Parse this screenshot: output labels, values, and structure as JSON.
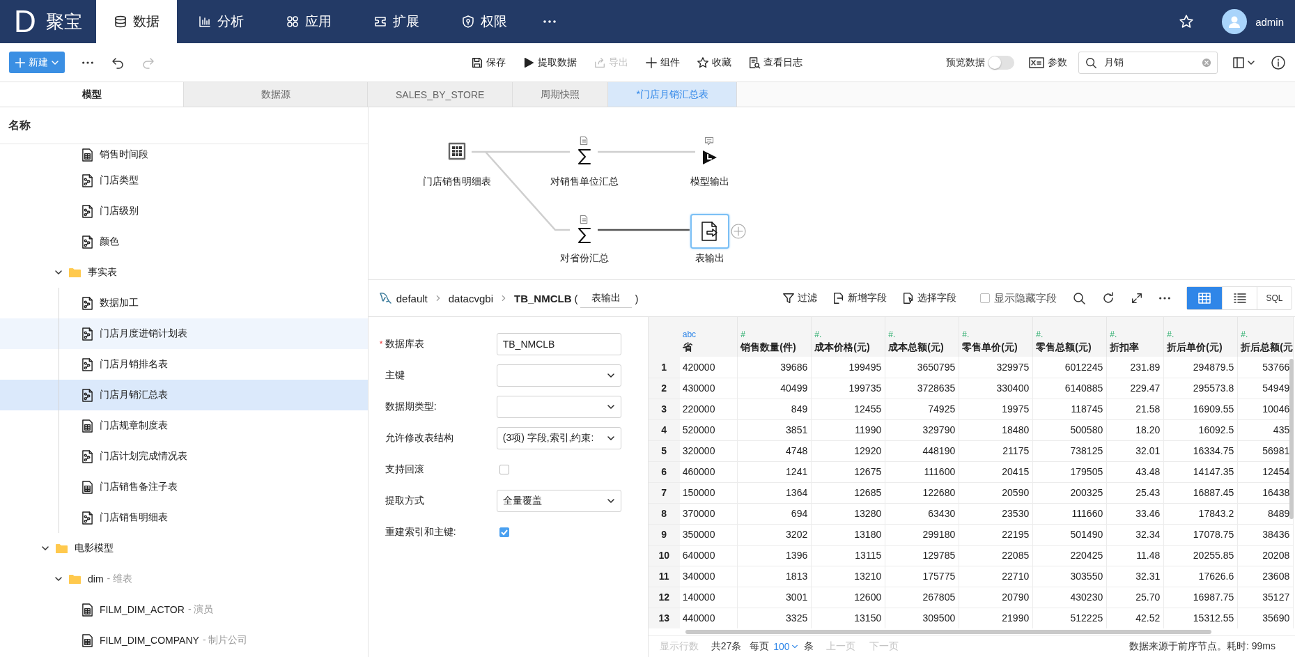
{
  "nav": {
    "logo_letter": "D",
    "product": "聚宝",
    "tabs": [
      {
        "label": "数据",
        "kind": "database",
        "selected": true
      },
      {
        "label": "分析",
        "kind": "bars",
        "selected": false
      },
      {
        "label": "应用",
        "kind": "apps",
        "selected": false
      },
      {
        "label": "扩展",
        "kind": "plugin",
        "selected": false
      },
      {
        "label": "权限",
        "kind": "shield",
        "selected": false
      }
    ],
    "user": "admin"
  },
  "toolbar": {
    "new_button": "新建",
    "undo_disabled": false,
    "redo_disabled": true,
    "actions": [
      {
        "label": "保存",
        "kind": "save",
        "disabled": false
      },
      {
        "label": "提取数据",
        "kind": "play",
        "disabled": false
      },
      {
        "label": "导出",
        "kind": "export",
        "disabled": true
      },
      {
        "label": "组件",
        "kind": "plus",
        "disabled": false
      },
      {
        "label": "收藏",
        "kind": "star",
        "disabled": false
      },
      {
        "label": "查看日志",
        "kind": "log",
        "disabled": false
      }
    ],
    "preview": {
      "label": "预览数据",
      "on": false
    },
    "params": "参数",
    "search": {
      "value": "月销"
    }
  },
  "panel_tabs": [
    {
      "label": "模型",
      "selected": true
    },
    {
      "label": "数据源",
      "selected": false
    }
  ],
  "doc_tabs": [
    {
      "label": "SALES_BY_STORE",
      "selected": false
    },
    {
      "label": "周期快照",
      "selected": false
    },
    {
      "label": "*门店月销汇总表",
      "selected": true
    }
  ],
  "tree": {
    "header": "名称",
    "items": [
      {
        "children": [
          {
            "children": [
              {
                "label": "销售时间段",
                "kind": "table",
                "selected": false,
                "hovered": false
              },
              {
                "label": "门店类型",
                "kind": "model",
                "selected": false,
                "hovered": false
              },
              {
                "label": "门店级别",
                "kind": "model",
                "selected": false,
                "hovered": false
              },
              {
                "label": "颜色",
                "kind": "model",
                "selected": false,
                "hovered": false
              }
            ]
          },
          {
            "label": "事实表",
            "kind": "folder",
            "expanded": true,
            "children": [
              {
                "label": "数据加工",
                "kind": "model",
                "selected": false,
                "hovered": false
              },
              {
                "label": "门店月度进销计划表",
                "kind": "model",
                "selected": false,
                "hovered": true
              },
              {
                "label": "门店月销排名表",
                "kind": "model",
                "selected": false,
                "hovered": false
              },
              {
                "label": "门店月销汇总表",
                "kind": "model",
                "selected": true,
                "hovered": false
              },
              {
                "label": "门店规章制度表",
                "kind": "table",
                "selected": false,
                "hovered": false
              },
              {
                "label": "门店计划完成情况表",
                "kind": "model",
                "selected": false,
                "hovered": false
              },
              {
                "label": "门店销售备注子表",
                "kind": "table",
                "selected": false,
                "hovered": false
              },
              {
                "label": "门店销售明细表",
                "kind": "model",
                "selected": false,
                "hovered": false
              }
            ]
          }
        ]
      },
      {
        "label": "电影模型",
        "kind": "folder",
        "expanded": true,
        "children": [
          {
            "label": "dim",
            "note": "- 维表",
            "kind": "folder",
            "expanded": true,
            "children": [
              {
                "label": "FILM_DIM_ACTOR",
                "note": "- 演员",
                "kind": "table",
                "selected": false,
                "hovered": false
              },
              {
                "label": "FILM_DIM_COMPANY",
                "note": "- 制片公司",
                "kind": "table",
                "selected": false,
                "hovered": false
              }
            ]
          }
        ]
      }
    ]
  },
  "flow": {
    "nodes": [
      {
        "label": "门店销售明细表",
        "kind": "source_table",
        "selected": false
      },
      {
        "label": "对销售单位汇总",
        "kind": "aggregate",
        "selected": false
      },
      {
        "label": "模型输出",
        "kind": "model_output",
        "selected": false
      },
      {
        "label": "对省份汇总",
        "kind": "aggregate",
        "selected": false
      },
      {
        "label": "表输出",
        "kind": "table_output",
        "selected": true
      }
    ]
  },
  "breadcrumb": {
    "items": [
      "default",
      "datacvgbi",
      "TB_NMCLB"
    ],
    "paren_open": "(",
    "node_type": "表输出",
    "paren_close": ")"
  },
  "data_toolbar": {
    "actions": [
      {
        "label": "过滤",
        "kind": "filter"
      },
      {
        "label": "新增字段",
        "kind": "add_field"
      },
      {
        "label": "选择字段",
        "kind": "select_field"
      }
    ],
    "show_hidden": {
      "label": "显示隐藏字段",
      "checked": false
    },
    "views": [
      {
        "kind": "grid",
        "selected": true
      },
      {
        "kind": "list",
        "selected": false
      },
      {
        "kind": "sql",
        "label": "SQL",
        "selected": false
      }
    ]
  },
  "form": [
    {
      "label": "数据库表",
      "required_mark": "*",
      "kind": "text",
      "value": "TB_NMCLB"
    },
    {
      "label": "主键",
      "kind": "select"
    },
    {
      "label": "数据期类型:",
      "kind": "select"
    },
    {
      "label": "允许修改表结构",
      "kind": "select",
      "value": "(3项) 字段,索引,约束:"
    },
    {
      "label": "支持回滚",
      "kind": "checkbox",
      "checked": false
    },
    {
      "label": "提取方式",
      "kind": "select",
      "value": "全量覆盖"
    },
    {
      "label": "重建索引和主键:",
      "kind": "checkbox",
      "checked": true
    }
  ],
  "table": {
    "columns": [
      {
        "kind": "string",
        "type_mark": "abc",
        "name": "省"
      },
      {
        "kind": "number",
        "type_mark": "#",
        "name": "销售数量(件)"
      },
      {
        "kind": "number",
        "type_mark": "#.",
        "name": "成本价格(元)"
      },
      {
        "kind": "number",
        "type_mark": "#.",
        "name": "成本总额(元)"
      },
      {
        "kind": "number",
        "type_mark": "#.",
        "name": "零售单价(元)"
      },
      {
        "kind": "number",
        "type_mark": "#.",
        "name": "零售总额(元)"
      },
      {
        "kind": "number",
        "type_mark": "#.",
        "name": "折扣率"
      },
      {
        "kind": "number",
        "type_mark": "#.",
        "name": "折后单价(元)"
      },
      {
        "kind": "number",
        "type_mark": "#.",
        "name": "折后总额(元"
      }
    ],
    "rows": [
      {
        "index": "1",
        "cells": [
          "420000",
          "39686",
          "199495",
          "3650795",
          "329975",
          "6012245",
          "231.89",
          "294879.5",
          "53766"
        ]
      },
      {
        "index": "2",
        "cells": [
          "430000",
          "40499",
          "199735",
          "3728635",
          "330400",
          "6140885",
          "229.47",
          "295573.8",
          "54949"
        ]
      },
      {
        "index": "3",
        "cells": [
          "220000",
          "849",
          "12455",
          "74925",
          "19975",
          "118745",
          "21.58",
          "16909.55",
          "10046"
        ]
      },
      {
        "index": "4",
        "cells": [
          "520000",
          "3851",
          "11990",
          "329790",
          "18480",
          "500580",
          "18.20",
          "16092.5",
          "435"
        ]
      },
      {
        "index": "5",
        "cells": [
          "320000",
          "4748",
          "12920",
          "448190",
          "21175",
          "738125",
          "32.01",
          "16334.75",
          "56981"
        ]
      },
      {
        "index": "6",
        "cells": [
          "460000",
          "1241",
          "12675",
          "111600",
          "20415",
          "179505",
          "43.48",
          "14147.35",
          "12454"
        ]
      },
      {
        "index": "7",
        "cells": [
          "150000",
          "1364",
          "12685",
          "122680",
          "20590",
          "200325",
          "25.43",
          "16887.45",
          "16438"
        ]
      },
      {
        "index": "8",
        "cells": [
          "370000",
          "694",
          "13280",
          "63430",
          "23530",
          "111660",
          "33.46",
          "17843.2",
          "8489"
        ]
      },
      {
        "index": "9",
        "cells": [
          "350000",
          "3202",
          "13180",
          "299180",
          "22195",
          "501490",
          "32.34",
          "17078.75",
          "38436"
        ]
      },
      {
        "index": "10",
        "cells": [
          "640000",
          "1396",
          "13115",
          "129785",
          "22085",
          "220425",
          "11.48",
          "20255.85",
          "20208"
        ]
      },
      {
        "index": "11",
        "cells": [
          "340000",
          "1813",
          "13210",
          "175775",
          "22710",
          "303550",
          "32.31",
          "17626.6",
          "23608"
        ]
      },
      {
        "index": "12",
        "cells": [
          "140000",
          "3001",
          "12600",
          "267805",
          "20790",
          "430230",
          "25.70",
          "16987.75",
          "35127"
        ]
      },
      {
        "index": "13",
        "cells": [
          "440000",
          "3325",
          "13150",
          "309500",
          "21990",
          "512225",
          "42.52",
          "15312.55",
          "35690"
        ]
      }
    ]
  },
  "pager": {
    "rows_label": "显示行数",
    "total": "共27条",
    "per_page_label": "每页",
    "per_page": "100",
    "unit": "条",
    "prev": "上一页",
    "next": "下一页",
    "status": "数据来源于前序节点。耗时: 99ms"
  }
}
